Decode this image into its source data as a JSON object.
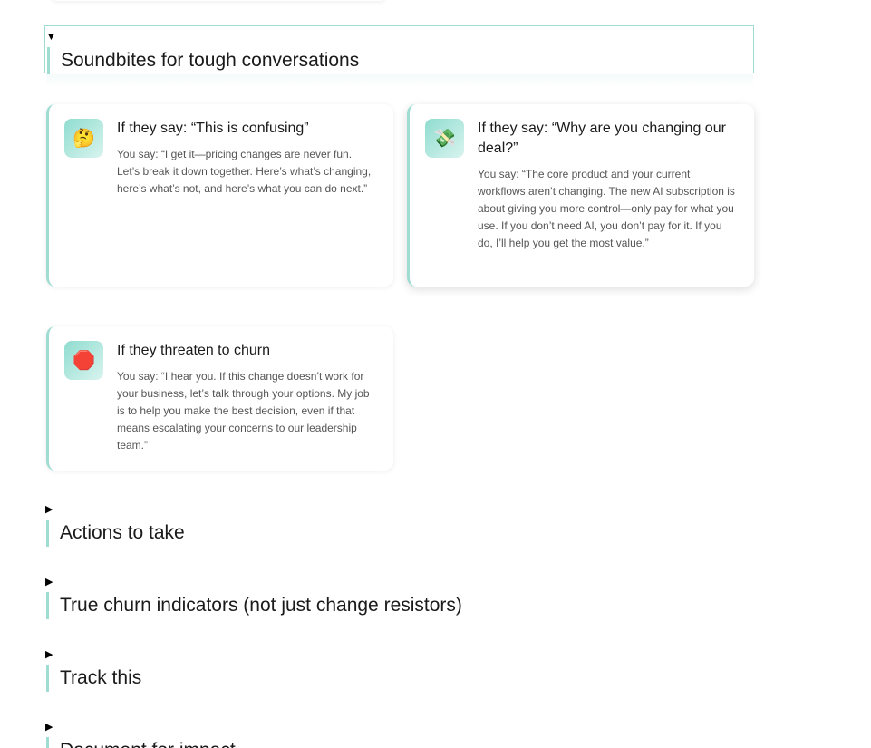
{
  "sections": {
    "soundbites": {
      "title": "Soundbites for tough conversations",
      "toggle": "▼",
      "cards": [
        {
          "icon": "thinking-face-icon",
          "emoji": "🤔",
          "title": "If they say: “This is confusing”",
          "body": "You say: “I get it—pricing changes are never fun. Let’s break it down together. Here’s what’s changing, here’s what’s not, and here’s what you can do next.”"
        },
        {
          "icon": "money-with-wings-icon",
          "emoji": "💸",
          "title": "If they say: “Why are you changing our deal?”",
          "body": "You say: “The core product and your current workflows aren’t changing. The new AI subscription is about giving you more control—only pay for what you use. If you don’t need AI, you don’t pay for it. If you do, I’ll help you get the most value.”"
        },
        {
          "icon": "stop-sign-icon",
          "emoji": "🛑",
          "title": "If they threaten to churn",
          "body": "You say: “I hear you. If this change doesn’t work for your business, let’s talk through your options. My job is to help you make the best decision, even if that means escalating your concerns to our leadership team.”"
        }
      ]
    },
    "collapsed": [
      {
        "toggle": "▶",
        "title": "Actions to take"
      },
      {
        "toggle": "▶",
        "title": "True churn indicators (not just change resistors)"
      },
      {
        "toggle": "▶",
        "title": "Track this"
      },
      {
        "toggle": "▶",
        "title": "Document for impact"
      }
    ]
  },
  "colors": {
    "accent": "#9fdcd2",
    "text": "#1a1a1a",
    "muted": "#555555"
  }
}
